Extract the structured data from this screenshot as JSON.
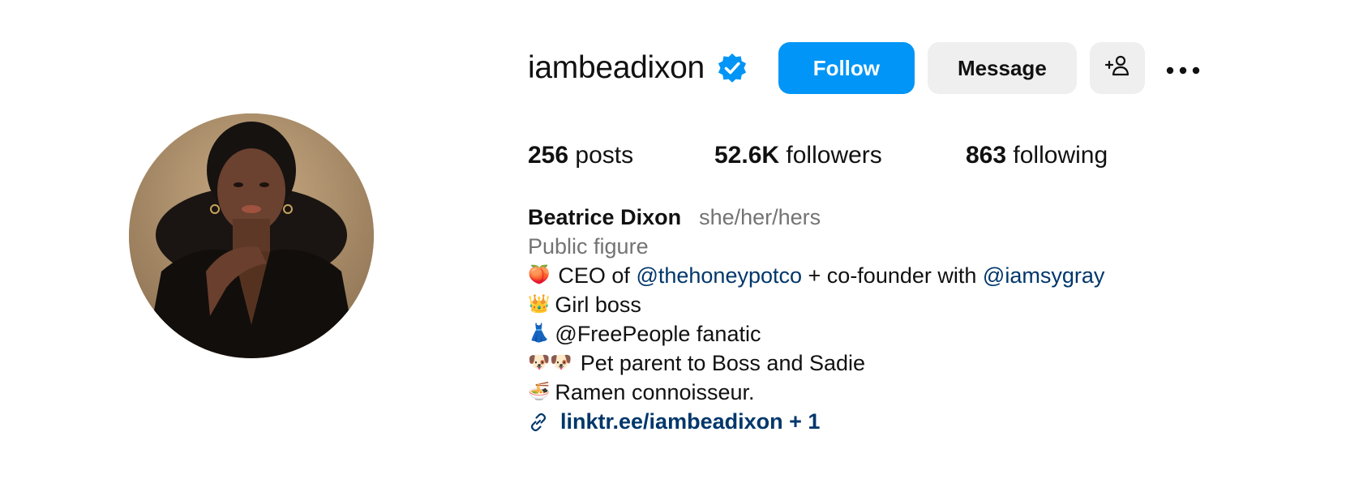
{
  "profile": {
    "username": "iambeadixon",
    "verified_icon": "verified-badge-icon",
    "follow_label": "Follow",
    "message_label": "Message",
    "add_user_icon": "add-user-icon",
    "more_icon": "more-options-icon",
    "avatar_icon": "profile-photo"
  },
  "stats": {
    "posts_count": "256",
    "posts_label": "posts",
    "followers_count": "52.6K",
    "followers_label": "followers",
    "following_count": "863",
    "following_label": "following"
  },
  "bio": {
    "full_name": "Beatrice Dixon",
    "pronouns": "she/her/hers",
    "category": "Public figure",
    "line1": {
      "emoji": "🍑",
      "prefix": "CEO of",
      "mention1": "@thehoneypotco",
      "middle": "+ co-founder with",
      "mention2": "@iamsygray"
    },
    "line2": {
      "emoji": "👑",
      "text": "Girl boss"
    },
    "line3": {
      "emoji": "👗",
      "text": "@FreePeople fanatic"
    },
    "line4": {
      "emoji": "🐶🐶",
      "text": "Pet parent to Boss and Sadie"
    },
    "line5": {
      "emoji": "🍜",
      "text": "Ramen connoisseur."
    },
    "link": {
      "icon": "link-icon",
      "text": "linktr.ee/iambeadixon + 1"
    }
  },
  "colors": {
    "follow_button": "#0095f6",
    "secondary_button": "#efefef",
    "verified_badge": "#0095f6",
    "mention_link": "#00376b",
    "muted_text": "#737373"
  }
}
